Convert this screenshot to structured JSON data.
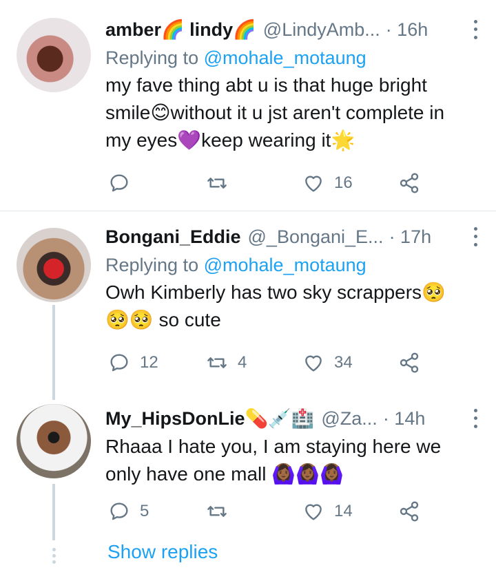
{
  "tweets": [
    {
      "name": "amber🌈 lindy🌈",
      "handle": "@LindyAmb...",
      "time": "· 16h",
      "replying_prefix": "Replying to",
      "replying_to": "@mohale_motaung",
      "text_lines": [
        "my fave thing abt u is that huge bright",
        "smile😊without it u jst aren't complete in",
        "my eyes💜keep wearing it🌟"
      ],
      "reply_count": "",
      "retweet_count": "",
      "like_count": "16"
    },
    {
      "name": "Bongani_Eddie",
      "handle": "@_Bongani_E...",
      "time": "· 17h",
      "replying_prefix": "Replying to",
      "replying_to": "@mohale_motaung",
      "text_lines": [
        "Owh Kimberly has two sky scrappers🥺",
        "🥺🥺 so cute"
      ],
      "reply_count": "12",
      "retweet_count": "4",
      "like_count": "34"
    },
    {
      "name": "My_HipsDonLie💊💉🏥",
      "handle": "@Za...",
      "time": "· 14h",
      "text_lines": [
        "Rhaaa I hate you, I am staying here we",
        "only have one mall 🙆🏾‍♀️🙆🏾‍♀️🙆🏾‍♀️"
      ],
      "reply_count": "5",
      "retweet_count": "",
      "like_count": "14"
    }
  ],
  "show_replies": "Show replies",
  "icons": {
    "reply": "reply-icon",
    "retweet": "retweet-icon",
    "like": "heart-icon",
    "share": "share-icon",
    "more": "more-icon"
  },
  "colors": {
    "link": "#1da1f2",
    "secondary": "#657786",
    "text": "#14171a",
    "thread_line": "#ccd6dd"
  }
}
